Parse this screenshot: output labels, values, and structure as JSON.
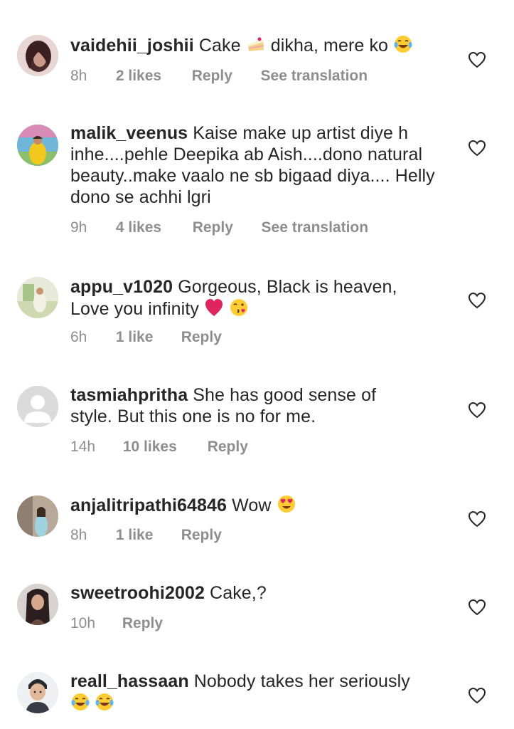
{
  "comments": [
    {
      "username": "vaidehii_joshii",
      "parts": [
        "Cake ",
        " dikha, mere ko"
      ],
      "emojis": [
        "cake-emoji",
        "tears-of-joy-emoji"
      ],
      "time": "8h",
      "likes": "2 likes",
      "reply": "Reply",
      "translate": "See translation"
    },
    {
      "username": "malik_veenus",
      "text": "Kaise make up artist diye h inhe....pehle Deepika ab Aish....dono natural beauty..make vaalo ne sb bigaad diya.... Helly dono se achhi lgri",
      "time": "9h",
      "likes": "4 likes",
      "reply": "Reply",
      "translate": "See translation"
    },
    {
      "username": "appu_v1020",
      "text": "Gorgeous, Black is heaven, Love you infinity",
      "emojis": [
        "red-heart-emoji",
        "kissing-face-emoji"
      ],
      "time": "6h",
      "likes": "1 like",
      "reply": "Reply"
    },
    {
      "username": "tasmiahpritha",
      "text": "She has good sense of style. But this one is no for me.",
      "time": "14h",
      "likes": "10 likes",
      "reply": "Reply"
    },
    {
      "username": "anjalitripathi64846",
      "text": "Wow",
      "emojis": [
        "heart-eyes-emoji"
      ],
      "time": "8h",
      "likes": "1 like",
      "reply": "Reply"
    },
    {
      "username": "sweetroohi2002",
      "text": "Cake,?",
      "time": "10h",
      "reply": "Reply"
    },
    {
      "username": "reall_hassaan",
      "text": "Nobody takes her seriously",
      "emojis": [
        "tears-of-joy-emoji",
        "tears-of-joy-emoji"
      ]
    }
  ],
  "icons": {
    "like": "heart-outline-icon"
  },
  "colors": {
    "text": "#262626",
    "meta": "#8e8e8e",
    "background": "#ffffff",
    "heart_emoji": "#e0245e",
    "emoji_yellow": "#ffcc33"
  }
}
